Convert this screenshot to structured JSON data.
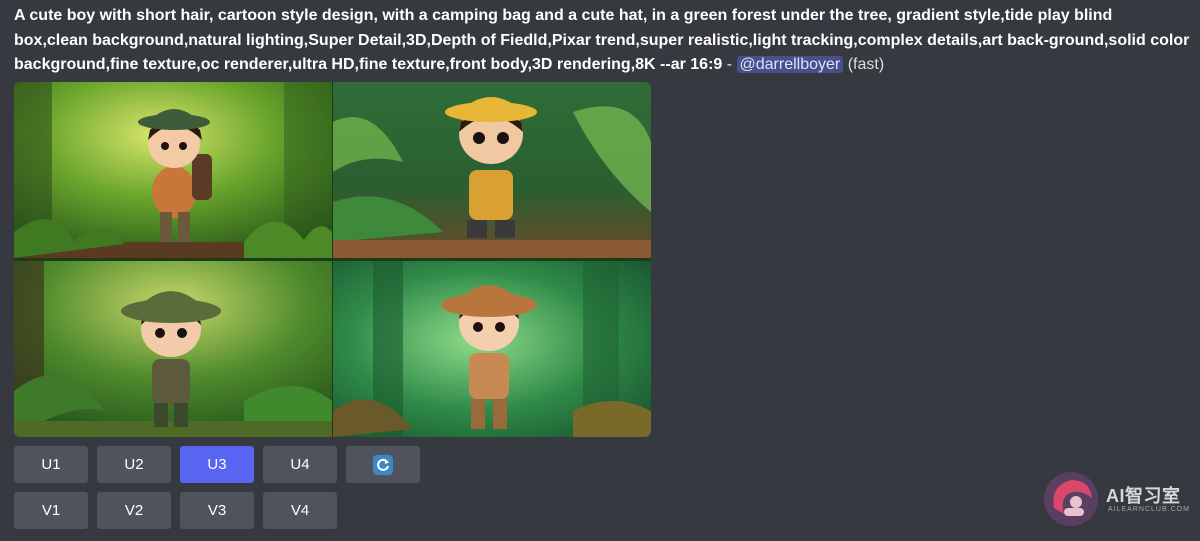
{
  "message": {
    "prompt": "A cute boy with short hair, cartoon style design, with a camping bag and a cute hat, in a green forest under the tree, gradient style,tide play blind box,clean background,natural lighting,Super Detail,3D,Depth of Fiedld,Pixar trend,super realistic,light tracking,complex details,art back-ground,solid color background,fine texture,oc renderer,ultra HD,fine texture,front body,3D rendering,8K --ar 16:9",
    "separator": " - ",
    "mention": "@darrellboyer",
    "mode": " (fast)"
  },
  "image_grid": {
    "tiles": [
      {
        "hat_color": "#3f5c3a",
        "outfit_color": "#c9763a",
        "bg_color": "#5f9a2b"
      },
      {
        "hat_color": "#e8b637",
        "outfit_color": "#d9a033",
        "bg_color": "#2f6d38"
      },
      {
        "hat_color": "#5b6b3a",
        "outfit_color": "#5c5a3a",
        "bg_color": "#3e7a2c"
      },
      {
        "hat_color": "#b8753c",
        "outfit_color": "#c88a52",
        "bg_color": "#2f8a48"
      }
    ]
  },
  "buttons": {
    "row1": [
      {
        "label": "U1",
        "active": false
      },
      {
        "label": "U2",
        "active": false
      },
      {
        "label": "U3",
        "active": true
      },
      {
        "label": "U4",
        "active": false
      }
    ],
    "reroll_icon": "refresh-icon",
    "row2": [
      {
        "label": "V1"
      },
      {
        "label": "V2"
      },
      {
        "label": "V3"
      },
      {
        "label": "V4"
      }
    ]
  },
  "watermark": {
    "brand": "AI智习室",
    "sub": "AILEARNCLUB.COM"
  },
  "colors": {
    "background": "#36393f",
    "button": "#4f545c",
    "button_active": "#5865f2",
    "mention_bg": "#4a4f8a"
  }
}
